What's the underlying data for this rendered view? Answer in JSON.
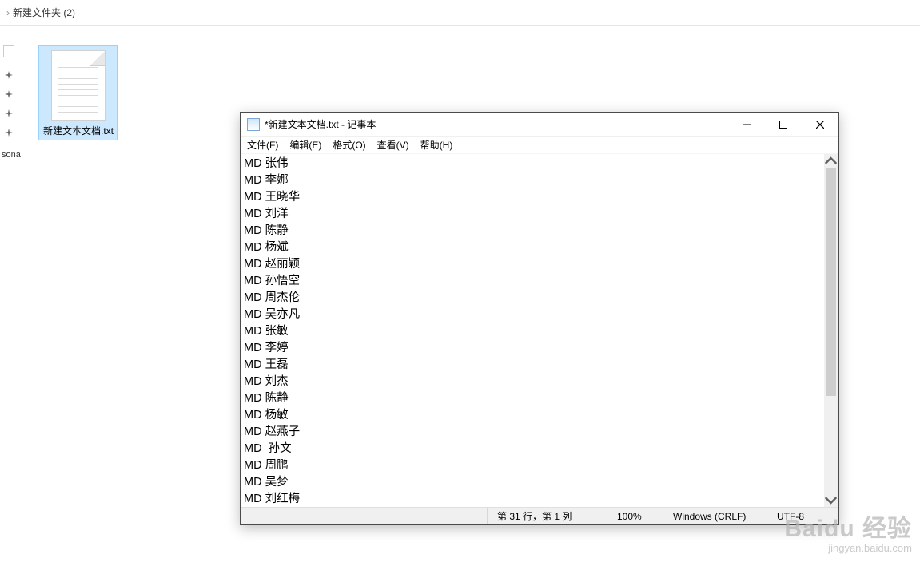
{
  "explorer": {
    "breadcrumb_chevron": "›",
    "breadcrumb": "新建文件夹 (2)",
    "sidebar_label": "sona",
    "file_label": "新建文本文档.txt"
  },
  "notepad": {
    "title": "*新建文本文档.txt - 记事本",
    "menu": {
      "file": "文件(F)",
      "edit": "编辑(E)",
      "format": "格式(O)",
      "view": "查看(V)",
      "help": "帮助(H)"
    },
    "lines": [
      "MD 张伟",
      "MD 李娜",
      "MD 王晓华",
      "MD 刘洋",
      "MD 陈静",
      "MD 杨斌",
      "MD 赵丽颖",
      "MD 孙悟空",
      "MD 周杰伦",
      "MD 吴亦凡",
      "MD 张敏",
      "MD 李婷",
      "MD 王磊",
      "MD 刘杰",
      "MD 陈静",
      "MD 杨敏",
      "MD 赵燕子",
      "MD  孙文",
      "MD 周鹏",
      "MD 吴梦",
      "MD 刘红梅"
    ],
    "status": {
      "position": "第 31 行，第 1 列",
      "zoom": "100%",
      "line_ending": "Windows (CRLF)",
      "encoding": "UTF-8"
    }
  },
  "watermark": {
    "brand": "Baidu 经验",
    "url": "jingyan.baidu.com"
  }
}
